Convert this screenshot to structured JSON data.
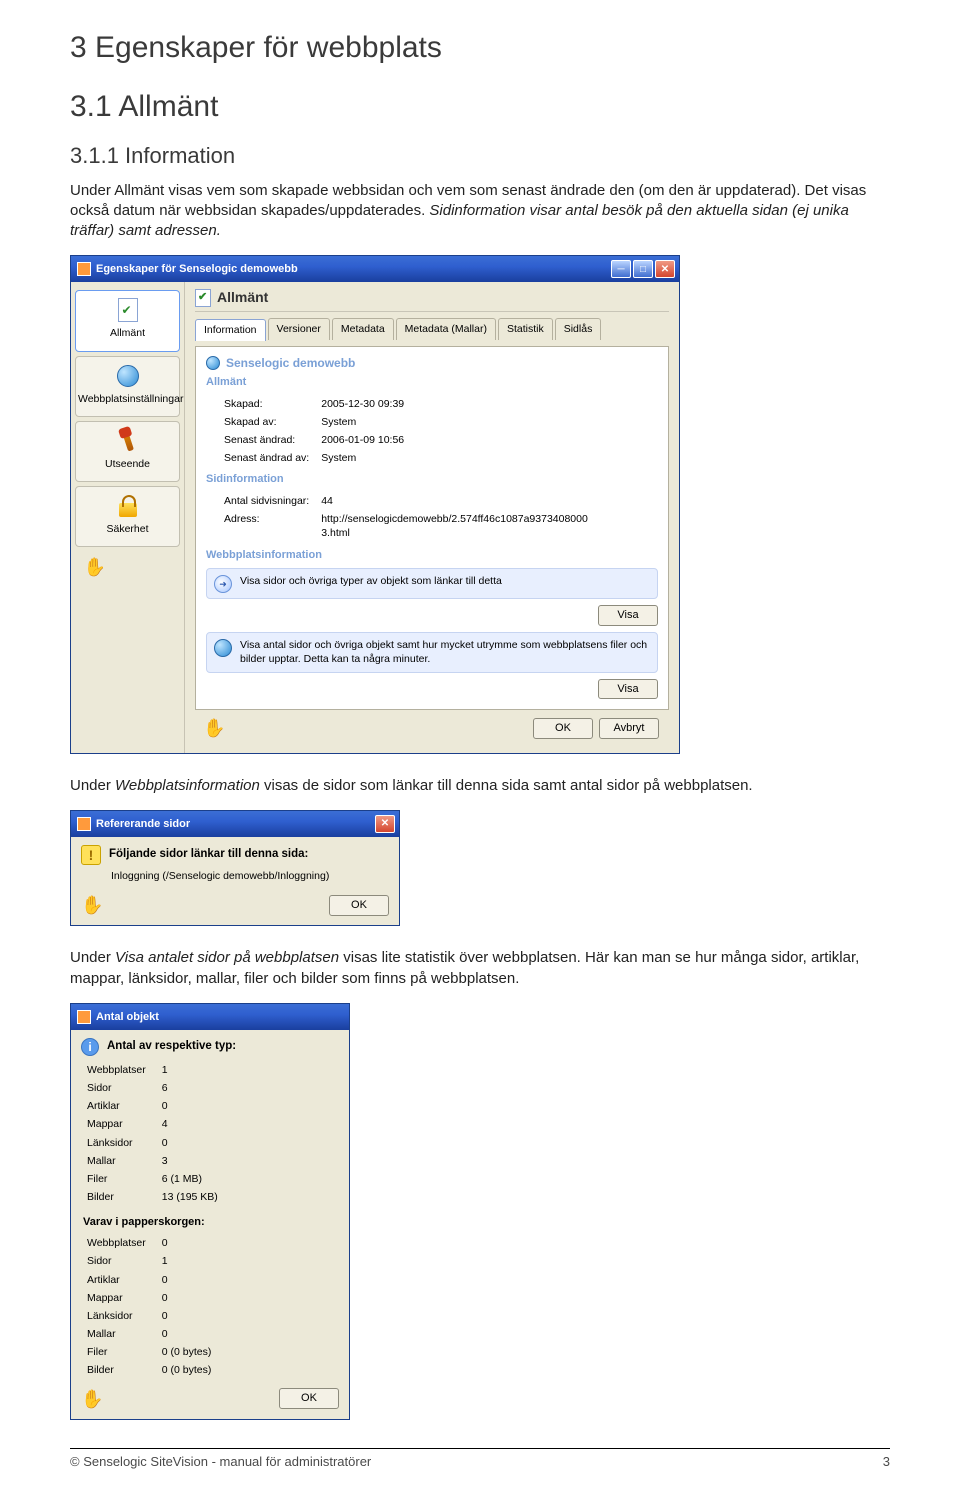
{
  "headings": {
    "h1": "3  Egenskaper för webbplats",
    "h2": "3.1  Allmänt",
    "h3": "3.1.1  Information"
  },
  "para1_a": "Under Allmänt visas vem som skapade webbsidan och vem som senast ändrade den (om den är uppdaterad). Det visas också datum när webbsidan skapades/uppdaterades. ",
  "para1_b": "Sidinformation visar antal besök på den aktuella sidan (ej unika träffar) samt adressen.",
  "win1": {
    "title": "Egenskaper för Senselogic demowebb",
    "nav": [
      "Allmänt",
      "Webbplatsinställningar",
      "Utseende",
      "Säkerhet"
    ],
    "pane_title": "Allmänt",
    "tabs": [
      "Information",
      "Versioner",
      "Metadata",
      "Metadata (Mallar)",
      "Statistik",
      "Sidlås"
    ],
    "site_name": "Senselogic demowebb",
    "group_allmant": "Allmänt",
    "kv_allmant": [
      [
        "Skapad:",
        "2005-12-30 09:39"
      ],
      [
        "Skapad av:",
        "System"
      ],
      [
        "Senast ändrad:",
        "2006-01-09 10:56"
      ],
      [
        "Senast ändrad av:",
        "System"
      ]
    ],
    "group_sid": "Sidinformation",
    "kv_sid": [
      [
        "Antal sidvisningar:",
        "44"
      ],
      [
        "Adress:",
        "http://senselogicdemowebb/2.574ff46c1087a9373408000 3.html"
      ]
    ],
    "group_web": "Webbplatsinformation",
    "info1": "Visa sidor och övriga typer av objekt som länkar till detta",
    "info2": "Visa antal sidor och övriga objekt samt hur mycket utrymme som webbplatsens filer och bilder upptar. Detta kan ta några minuter.",
    "btn_visa": "Visa",
    "btn_ok": "OK",
    "btn_cancel": "Avbryt"
  },
  "para2_a": "Under ",
  "para2_b": "Webbplatsinformation",
  "para2_c": " visas de sidor som länkar till denna sida samt antal sidor på webbplatsen.",
  "win2": {
    "title": "Refererande sidor",
    "head": "Följande sidor länkar till denna sida:",
    "item": "Inloggning (/Senselogic demowebb/Inloggning)",
    "btn_ok": "OK"
  },
  "para3_a": "Under ",
  "para3_b": "Visa antalet sidor på webbplatsen",
  "para3_c": " visas lite statistik över webbplatsen. Här kan man se hur många sidor, artiklar, mappar, länksidor, mallar, filer och bilder som finns på webbplatsen.",
  "win3": {
    "title": "Antal objekt",
    "head": "Antal av respektive typ:",
    "rows": [
      [
        "Webbplatser",
        "1"
      ],
      [
        "Sidor",
        "6"
      ],
      [
        "Artiklar",
        "0"
      ],
      [
        "Mappar",
        "4"
      ],
      [
        "Länksidor",
        "0"
      ],
      [
        "Mallar",
        "3"
      ],
      [
        "Filer",
        "6 (1 MB)"
      ],
      [
        "Bilder",
        "13 (195 KB)"
      ]
    ],
    "sub": "Varav i papperskorgen:",
    "rows2": [
      [
        "Webbplatser",
        "0"
      ],
      [
        "Sidor",
        "1"
      ],
      [
        "Artiklar",
        "0"
      ],
      [
        "Mappar",
        "0"
      ],
      [
        "Länksidor",
        "0"
      ],
      [
        "Mallar",
        "0"
      ],
      [
        "Filer",
        "0 (0 bytes)"
      ],
      [
        "Bilder",
        "0 (0 bytes)"
      ]
    ],
    "btn_ok": "OK"
  },
  "footer": {
    "left": "© Senselogic SiteVision - manual för administratörer",
    "right": "3"
  }
}
